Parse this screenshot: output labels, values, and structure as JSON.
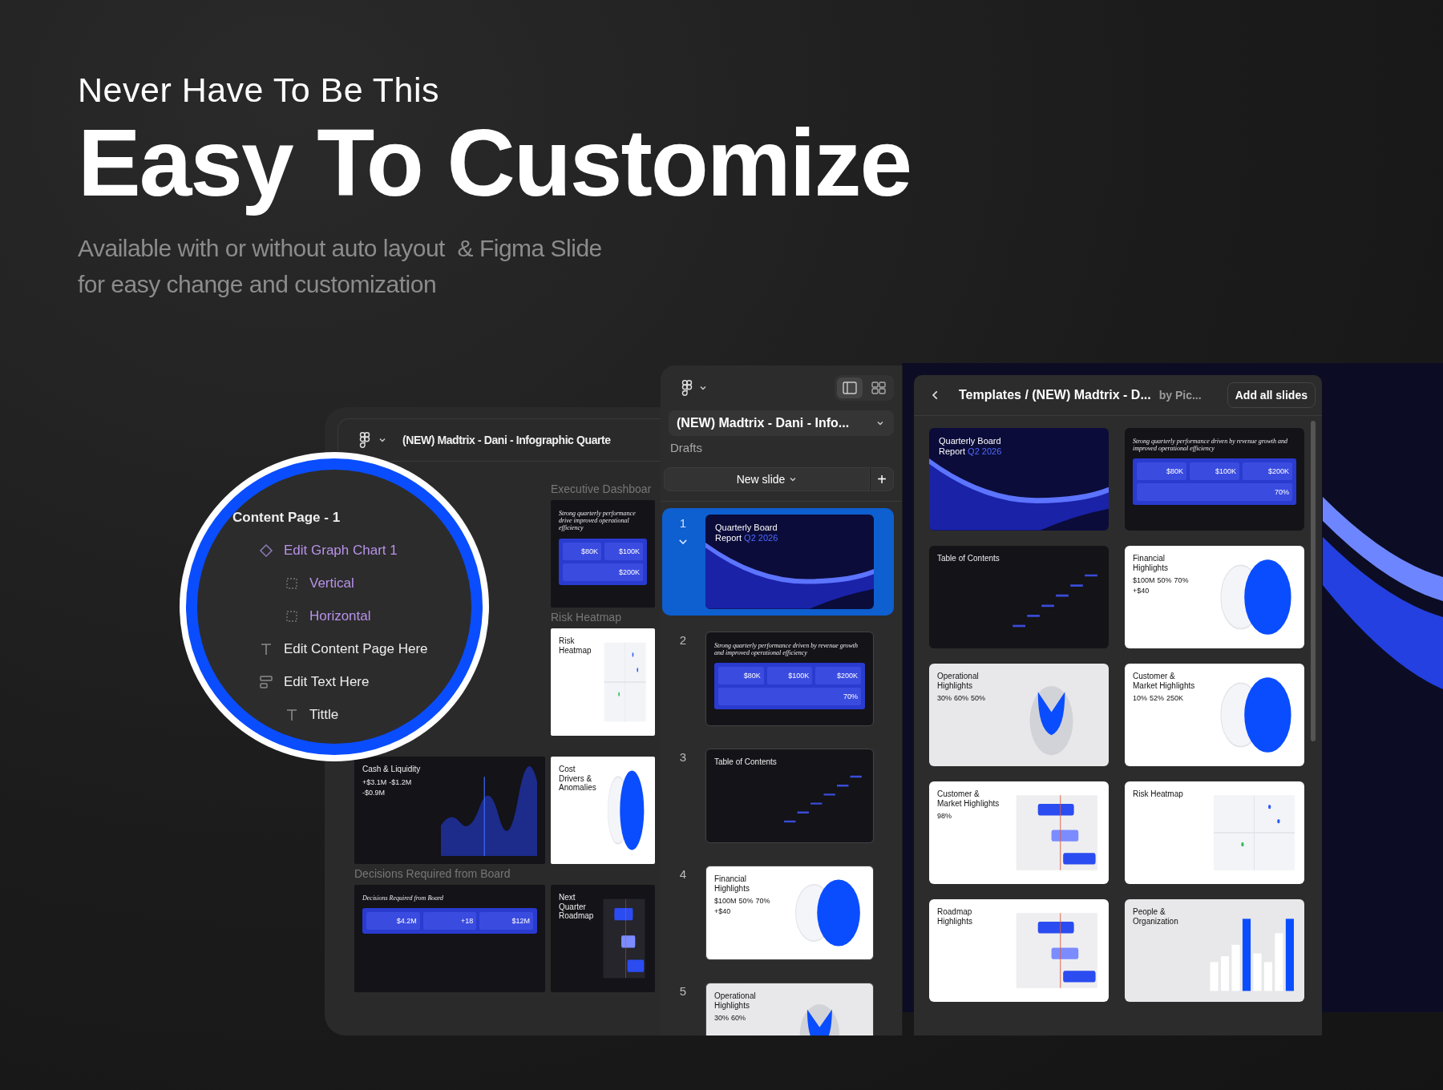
{
  "hero": {
    "eyebrow": "Never Have To Be This",
    "headline": "Easy To Customize",
    "subtitle": [
      "Available with or without auto layout  & Figma Slide",
      "for easy change and customization"
    ]
  },
  "editor_window": {
    "title": "(NEW) Madtrix - Dani - Infographic Quarte",
    "slides": [
      {
        "caption": "Executive Dashboar",
        "kind": "tiles",
        "dark": true,
        "muted": false,
        "title": "Strong quarterly performance drive improved operational efficiency",
        "stats": [
          "$80K",
          "$100K",
          "$200K"
        ]
      },
      {
        "caption": "Risk Heatmap",
        "kind": "scatter",
        "dark": false,
        "muted": false,
        "title": "Risk Heatmap"
      },
      {
        "kind": "area",
        "dark": true,
        "muted": false,
        "title": "Cash & Liquidity",
        "stats": [
          "+$3.1M",
          "-$1.2M",
          "-$0.9M"
        ]
      },
      {
        "kind": "circles",
        "dark": false,
        "muted": false,
        "title": "Cost Drivers & Anomalies"
      },
      {
        "caption": "Decisions Required from Board",
        "kind": "tiles",
        "dark": true,
        "muted": false,
        "title": "Decisions Required from Board",
        "stats": [
          "$4.2M",
          "+18",
          "$12M"
        ]
      },
      {
        "kind": "timeline",
        "dark": true,
        "muted": false,
        "title": "Next Quarter Roadmap"
      }
    ]
  },
  "layers_magnifier": {
    "layers": [
      {
        "name": "Content Page - 1",
        "kind": "frame",
        "children": [
          {
            "name": "Edit Graph Chart 1",
            "kind": "component",
            "children": [
              {
                "name": "Vertical",
                "kind": "placeholder"
              },
              {
                "name": "Horizontal",
                "kind": "placeholder"
              }
            ]
          },
          {
            "name": "Edit Content Page Here",
            "kind": "text"
          },
          {
            "name": "Edit Text Here",
            "kind": "autolayout",
            "children": [
              {
                "name": "Tittle",
                "kind": "text"
              }
            ]
          }
        ]
      }
    ]
  },
  "slides_panel": {
    "file_title": "(NEW) Madtrix - Dani - Info...",
    "location": "Drafts",
    "new_slide": "New slide",
    "add_button": "+",
    "view_modes": [
      {
        "kind": "single",
        "selected": true
      },
      {
        "kind": "grid",
        "selected": false
      }
    ],
    "slides": [
      {
        "number": "1",
        "selected": true,
        "kind": "cover",
        "dark": true,
        "muted": false,
        "title": "Quarterly Board Report",
        "accent": "Q2 2026"
      },
      {
        "number": "2",
        "selected": false,
        "kind": "tiles",
        "dark": true,
        "muted": false,
        "title": "Strong quarterly performance driven by revenue growth and improved operational efficiency",
        "stats": [
          "$80K",
          "$100K",
          "$200K",
          "70%"
        ]
      },
      {
        "number": "3",
        "selected": false,
        "kind": "steps",
        "dark": true,
        "muted": false,
        "title": "Table of Contents"
      },
      {
        "number": "4",
        "selected": false,
        "kind": "circles",
        "dark": false,
        "muted": false,
        "title": "Financial Highlights",
        "stats": [
          "$100M",
          "50%",
          "70%",
          "+$40"
        ]
      },
      {
        "number": "5",
        "selected": false,
        "kind": "pie",
        "dark": false,
        "muted": true,
        "title": "Operational Highlights",
        "stats": [
          "30%",
          "60%"
        ]
      }
    ]
  },
  "templates_panel": {
    "breadcrumb": "Templates / (NEW) Madtrix - D...",
    "author": "by Pic...",
    "add_all": "Add all slides",
    "slides": [
      {
        "kind": "cover",
        "dark": true,
        "muted": false,
        "title": "Quarterly Board Report",
        "accent": "Q2 2026"
      },
      {
        "kind": "tiles",
        "dark": true,
        "muted": false,
        "title": "Strong quarterly performance driven by revenue growth and improved operational efficiency",
        "stats": [
          "$80K",
          "$100K",
          "$200K",
          "70%"
        ]
      },
      {
        "kind": "steps",
        "dark": true,
        "muted": false,
        "title": "Table of Contents"
      },
      {
        "kind": "circles",
        "dark": false,
        "muted": false,
        "title": "Financial Highlights",
        "stats": [
          "$100M",
          "50%",
          "70%",
          "+$40"
        ]
      },
      {
        "kind": "pie",
        "dark": false,
        "muted": true,
        "title": "Operational Highlights",
        "stats": [
          "30%",
          "60%",
          "50%"
        ]
      },
      {
        "kind": "circles",
        "dark": false,
        "muted": false,
        "title": "Customer & Market Highlights",
        "stats": [
          "10%",
          "52%",
          "250K"
        ]
      },
      {
        "kind": "timeline",
        "dark": false,
        "muted": false,
        "title": "Customer & Market Highlights",
        "stats": [
          "98%"
        ]
      },
      {
        "kind": "scatter",
        "dark": false,
        "muted": false,
        "title": "Risk Heatmap"
      },
      {
        "kind": "timeline",
        "dark": false,
        "muted": false,
        "title": "Roadmap Highlights"
      },
      {
        "kind": "bars",
        "dark": false,
        "muted": true,
        "title": "People & Organization"
      }
    ]
  }
}
